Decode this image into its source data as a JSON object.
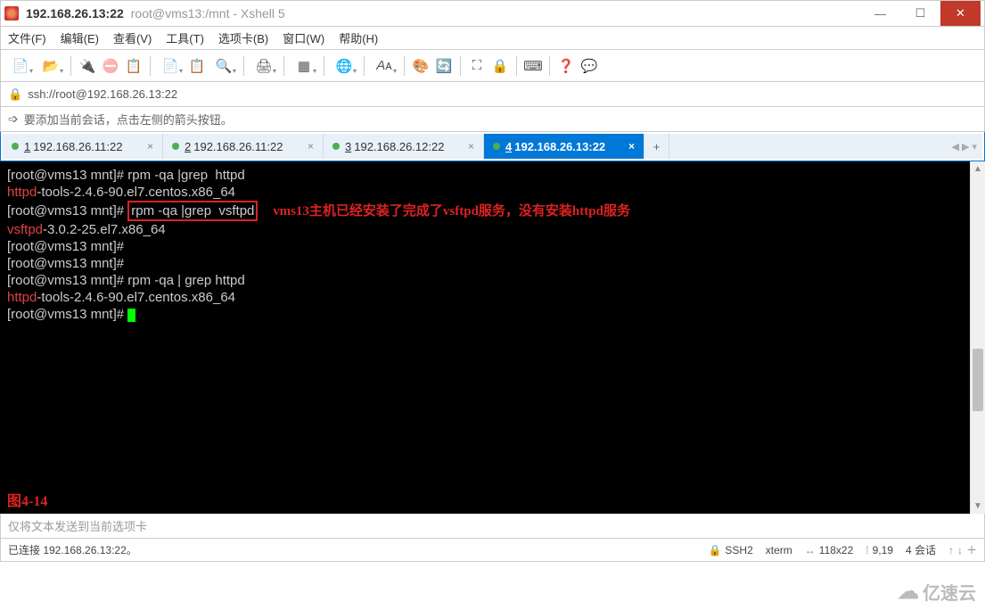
{
  "title": {
    "host": "192.168.26.13:22",
    "sub": "root@vms13:/mnt - Xshell 5"
  },
  "menu": {
    "file": "文件(F)",
    "edit": "编辑(E)",
    "view": "查看(V)",
    "tools": "工具(T)",
    "tabs": "选项卡(B)",
    "window": "窗口(W)",
    "help": "帮助(H)"
  },
  "address": {
    "url": "ssh://root@192.168.26.13:22"
  },
  "hint": {
    "text": "要添加当前会话，点击左侧的箭头按钮。"
  },
  "tabs": [
    {
      "num": "1",
      "label": "192.168.26.11:22",
      "active": false
    },
    {
      "num": "2",
      "label": "192.168.26.11:22",
      "active": false
    },
    {
      "num": "3",
      "label": "192.168.26.12:22",
      "active": false
    },
    {
      "num": "4",
      "label": "192.168.26.13:22",
      "active": true
    }
  ],
  "terminal": {
    "l1_prompt": "[root@vms13 mnt]# ",
    "l1_cmd": "rpm -qa |grep  httpd",
    "l2a": "httpd",
    "l2b": "-tools-2.4.6-90.el7.centos.x86_64",
    "l3_prompt": "[root@vms13 mnt]# ",
    "l3_cmd": "rpm -qa |grep  vsftpd",
    "l3_annotation": "vms13主机已经安装了完成了vsftpd服务，没有安装httpd服务",
    "l4a": "vsftpd",
    "l4b": "-3.0.2-25.el7.x86_64",
    "l5": "[root@vms13 mnt]# ",
    "l6": "[root@vms13 mnt]# ",
    "l7_prompt": "[root@vms13 mnt]# ",
    "l7_cmd": "rpm -qa | grep httpd",
    "l8a": "httpd",
    "l8b": "-tools-2.4.6-90.el7.centos.x86_64",
    "l9": "[root@vms13 mnt]# ",
    "figure": "图4-14"
  },
  "sendbar": {
    "placeholder": "仅将文本发送到当前选项卡"
  },
  "status": {
    "conn": "已连接 192.168.26.13:22。",
    "ssh": "SSH2",
    "term": "xterm",
    "size": "118x22",
    "pos": "9,19",
    "sessions": "4 会话"
  },
  "watermark": {
    "text": "亿速云"
  }
}
